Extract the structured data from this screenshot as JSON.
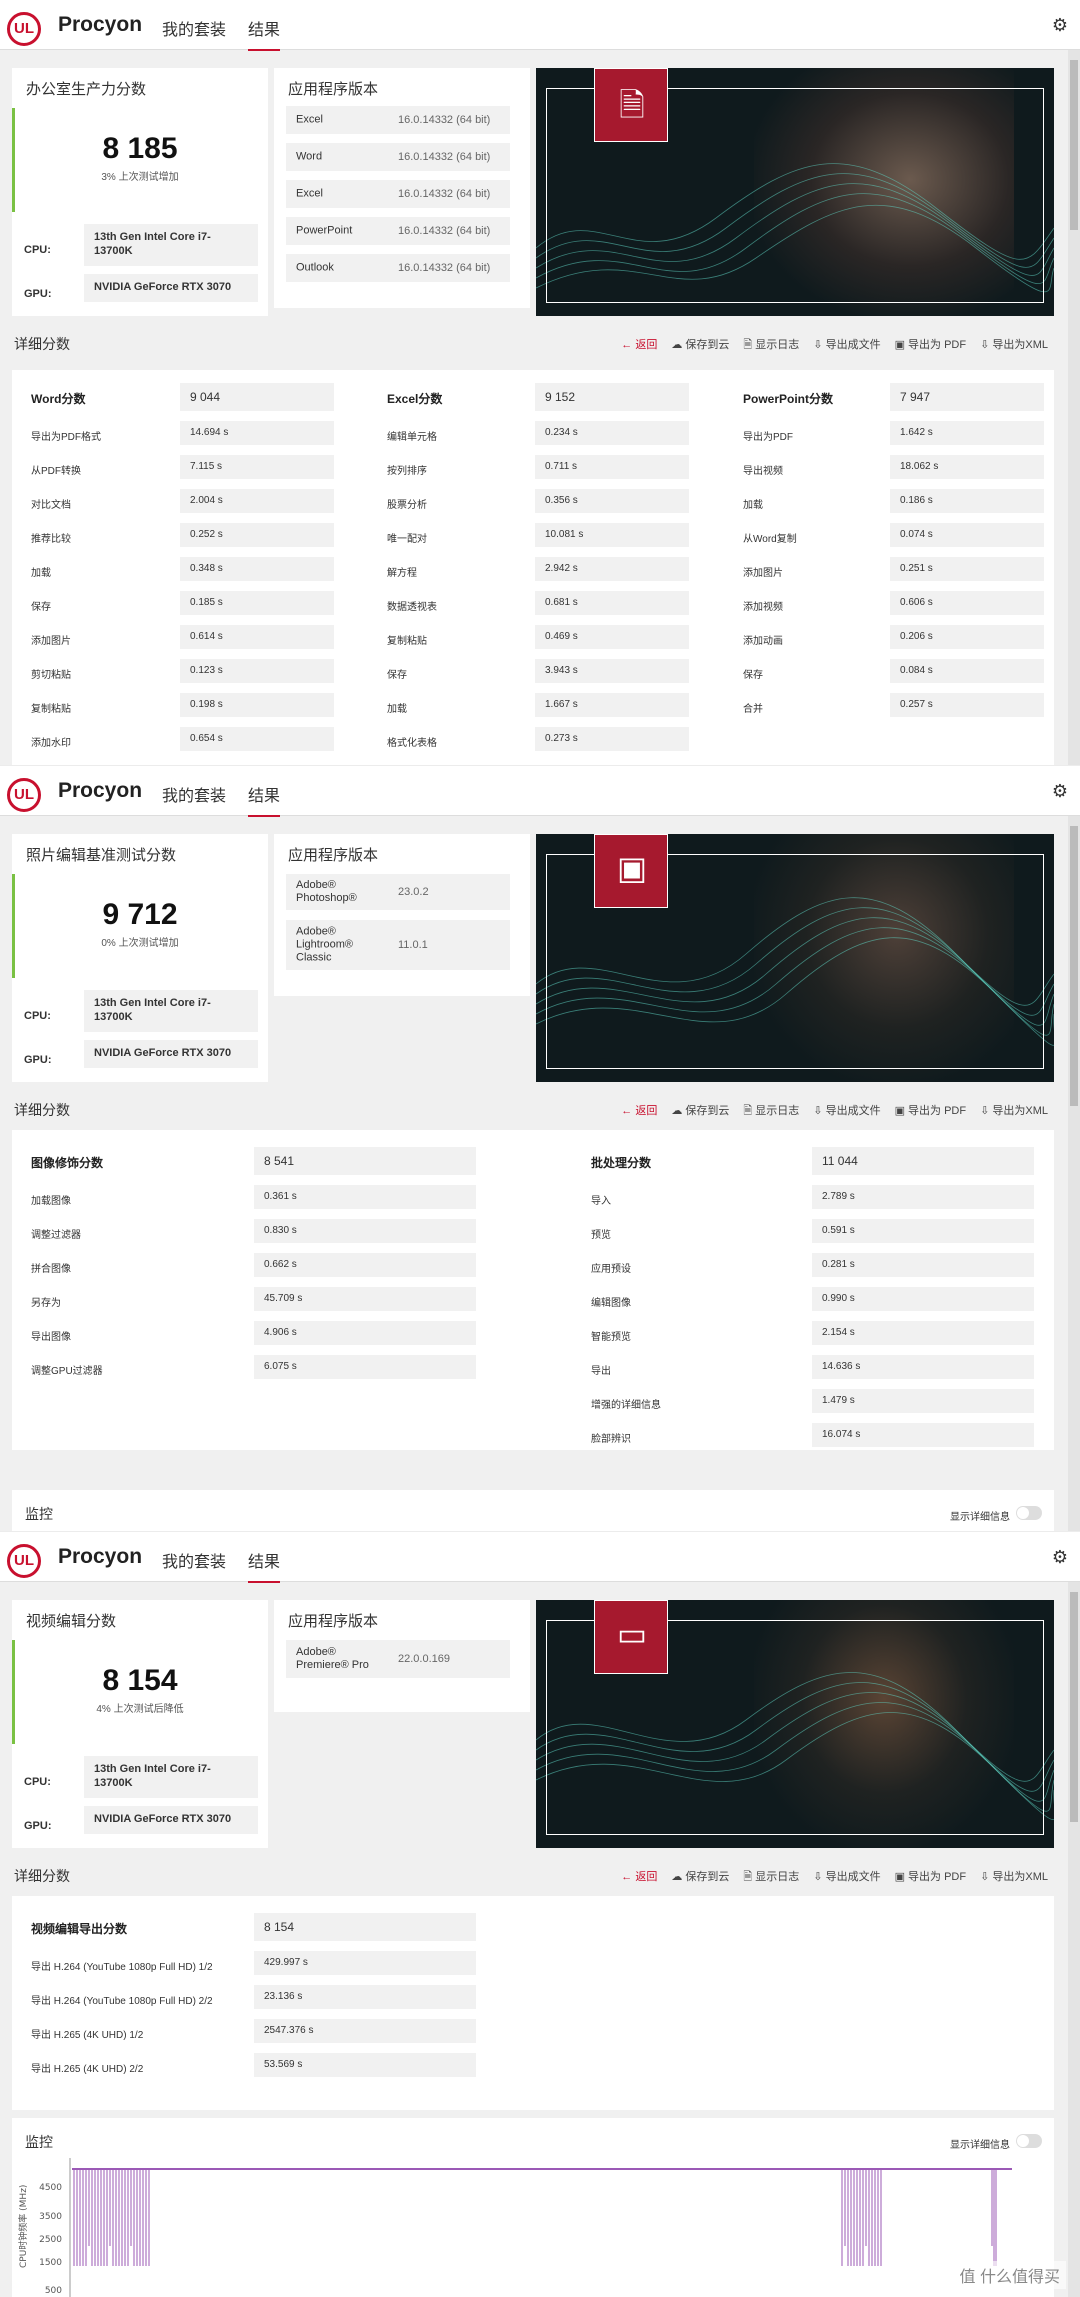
{
  "app": {
    "brand": "Procyon",
    "logo": "UL",
    "nav_suites": "我的套装",
    "nav_results": "结果"
  },
  "toolbar": {
    "back": "返回",
    "save_cloud": "保存到云",
    "show_log": "显示日志",
    "export_file": "导出成文件",
    "export_pdf": "导出为 PDF",
    "export_xml": "导出为XML"
  },
  "common": {
    "versions_title": "应用程序版本",
    "detail_title": "详细分数",
    "cpu_label": "CPU:",
    "gpu_label": "GPU:",
    "cpu": "13th Gen Intel Core i7-13700K",
    "gpu": "NVIDIA GeForce RTX 3070",
    "monitor_title": "监控",
    "monitor_toggle": "显示详细信息"
  },
  "office": {
    "score_title": "办公室生产力分数",
    "score": "8 185",
    "score_sub": "3% 上次测试增加",
    "versions": [
      {
        "name": "Excel",
        "version": "16.0.14332 (64 bit)"
      },
      {
        "name": "Word",
        "version": "16.0.14332 (64 bit)"
      },
      {
        "name": "Excel",
        "version": "16.0.14332 (64 bit)"
      },
      {
        "name": "PowerPoint",
        "version": "16.0.14332 (64 bit)"
      },
      {
        "name": "Outlook",
        "version": "16.0.14332 (64 bit)"
      }
    ],
    "columns": [
      {
        "head": "Word分数",
        "head_val": "9 044",
        "rows": [
          [
            "导出为PDF格式",
            "14.694 s"
          ],
          [
            "从PDF转换",
            "7.115 s"
          ],
          [
            "对比文档",
            "2.004 s"
          ],
          [
            "推荐比较",
            "0.252 s"
          ],
          [
            "加载",
            "0.348 s"
          ],
          [
            "保存",
            "0.185 s"
          ],
          [
            "添加图片",
            "0.614 s"
          ],
          [
            "剪切粘贴",
            "0.123 s"
          ],
          [
            "复制粘贴",
            "0.198 s"
          ],
          [
            "添加水印",
            "0.654 s"
          ]
        ]
      },
      {
        "head": "Excel分数",
        "head_val": "9 152",
        "rows": [
          [
            "编辑单元格",
            "0.234 s"
          ],
          [
            "按列排序",
            "0.711 s"
          ],
          [
            "股票分析",
            "0.356 s"
          ],
          [
            "唯一配对",
            "10.081 s"
          ],
          [
            "解方程",
            "2.942 s"
          ],
          [
            "数据透视表",
            "0.681 s"
          ],
          [
            "复制粘贴",
            "0.469 s"
          ],
          [
            "保存",
            "3.943 s"
          ],
          [
            "加载",
            "1.667 s"
          ],
          [
            "格式化表格",
            "0.273 s"
          ]
        ]
      },
      {
        "head": "PowerPoint分数",
        "head_val": "7 947",
        "rows": [
          [
            "导出为PDF",
            "1.642 s"
          ],
          [
            "导出视频",
            "18.062 s"
          ],
          [
            "加载",
            "0.186 s"
          ],
          [
            "从Word复制",
            "0.074 s"
          ],
          [
            "添加图片",
            "0.251 s"
          ],
          [
            "添加视频",
            "0.606 s"
          ],
          [
            "添加动画",
            "0.206 s"
          ],
          [
            "保存",
            "0.084 s"
          ],
          [
            "合并",
            "0.257 s"
          ]
        ]
      }
    ]
  },
  "photo": {
    "score_title": "照片编辑基准测试分数",
    "score": "9 712",
    "score_sub": "0% 上次测试增加",
    "versions": [
      {
        "name": "Adobe® Photoshop®",
        "version": "23.0.2"
      },
      {
        "name": "Adobe® Lightroom® Classic",
        "version": "11.0.1"
      }
    ],
    "columns": [
      {
        "head": "图像修饰分数",
        "head_val": "8 541",
        "rows": [
          [
            "加载图像",
            "0.361 s"
          ],
          [
            "调整过滤器",
            "0.830 s"
          ],
          [
            "拼合图像",
            "0.662 s"
          ],
          [
            "另存为",
            "45.709 s"
          ],
          [
            "导出图像",
            "4.906 s"
          ],
          [
            "调整GPU过滤器",
            "6.075 s"
          ]
        ]
      },
      {
        "head": "批处理分数",
        "head_val": "11 044",
        "rows": [
          [
            "导入",
            "2.789 s"
          ],
          [
            "预览",
            "0.591 s"
          ],
          [
            "应用预设",
            "0.281 s"
          ],
          [
            "编辑图像",
            "0.990 s"
          ],
          [
            "智能预览",
            "2.154 s"
          ],
          [
            "导出",
            "14.636 s"
          ],
          [
            "增强的详细信息",
            "1.479 s"
          ],
          [
            "脸部辨识",
            "16.074 s"
          ]
        ]
      }
    ]
  },
  "video": {
    "score_title": "视频编辑分数",
    "score": "8 154",
    "score_sub": "4% 上次测试后降低",
    "versions": [
      {
        "name": "Adobe® Premiere® Pro",
        "version": "22.0.0.169"
      }
    ],
    "columns": [
      {
        "head": "视频编辑导出分数",
        "head_val": "8 154",
        "rows": [
          [
            "导出 H.264 (YouTube 1080p Full HD) 1/2",
            "429.997 s"
          ],
          [
            "导出 H.264 (YouTube 1080p Full HD) 2/2",
            "23.136 s"
          ],
          [
            "导出 H.265 (4K UHD) 1/2",
            "2547.376 s"
          ],
          [
            "导出 H.265 (4K UHD) 2/2",
            "53.569 s"
          ]
        ]
      }
    ],
    "chart_data": {
      "type": "line",
      "title": "",
      "ylabel": "CPU时钟频率 (MHz)",
      "yticks": [
        "4500",
        "3500",
        "2500",
        "1500",
        "500"
      ],
      "ylim": [
        0,
        5000
      ],
      "series": [
        {
          "name": "",
          "color": "#9b59b6",
          "note_values": [
            4800,
            1500,
            4800,
            4800,
            1500,
            4800
          ]
        }
      ]
    }
  },
  "watermark": "值 什么值得买",
  "colors": {
    "accent": "#c8102e",
    "score_bar": "#7ac143",
    "chart_line": "#9b59b6"
  }
}
